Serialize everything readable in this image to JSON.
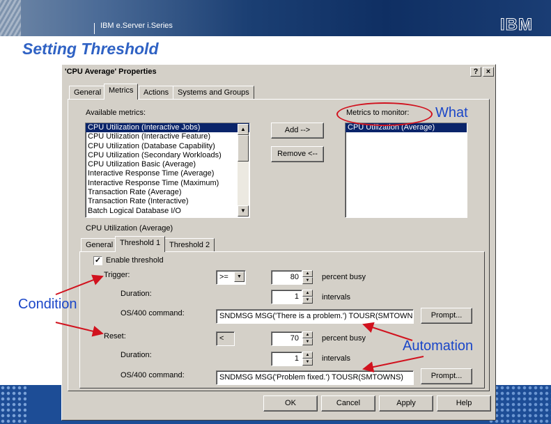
{
  "slide": {
    "brand": "IBM e.Server i.Series",
    "logo_text": "IBM",
    "title": "Setting Threshold"
  },
  "dialog": {
    "title": "'CPU Average' Properties",
    "help_button": "?",
    "close_button": "×",
    "tabs": [
      "General",
      "Metrics",
      "Actions",
      "Systems and Groups"
    ],
    "active_tab": "Metrics",
    "available_label": "Available metrics:",
    "available_metrics": [
      "CPU Utilization (Interactive Jobs)",
      "CPU Utilization (Interactive Feature)",
      "CPU Utilization (Database Capability)",
      "CPU Utilization (Secondary Workloads)",
      "CPU Utilization Basic (Average)",
      "Interactive Response Time (Average)",
      "Interactive Response Time (Maximum)",
      "Transaction Rate (Average)",
      "Transaction Rate (Interactive)",
      "Batch Logical Database I/O"
    ],
    "add_button": "Add -->",
    "remove_button": "Remove <--",
    "monitor_label": "Metrics to monitor:",
    "monitor_metrics": [
      "CPU Utilization (Average)"
    ],
    "selected_metric_label": "CPU Utilization (Average)",
    "sub_tabs": [
      "General",
      "Threshold 1",
      "Threshold 2"
    ],
    "active_sub_tab": "Threshold 1",
    "threshold": {
      "enable_label": "Enable threshold",
      "enabled": true,
      "enabled_glyph": "✓",
      "trigger_label": "Trigger:",
      "trigger_operator": ">=",
      "trigger_value": "80",
      "trigger_unit": "percent busy",
      "duration_label": "Duration:",
      "trigger_duration": "1",
      "duration_unit": "intervals",
      "command_label": "OS/400 command:",
      "trigger_command": "SNDMSG MSG('There is a problem.') TOUSR(SMTOWNS",
      "prompt_button": "Prompt...",
      "reset_label": "Reset:",
      "reset_operator": "<",
      "reset_value": "70",
      "reset_unit": "percent busy",
      "reset_duration": "1",
      "reset_command": "SNDMSG MSG('Problem fixed.') TOUSR(SMTOWNS)"
    },
    "buttons": {
      "ok": "OK",
      "cancel": "Cancel",
      "apply": "Apply",
      "help": "Help"
    }
  },
  "annotations": {
    "what": "What",
    "condition": "Condition",
    "automation": "Automation",
    "color": "#1a46c8",
    "arrow_color": "#d1121e"
  },
  "icons": {
    "scroll_up": "▲",
    "scroll_down": "▼",
    "spin_up": "▲",
    "spin_down": "▼",
    "combo": "▼"
  }
}
